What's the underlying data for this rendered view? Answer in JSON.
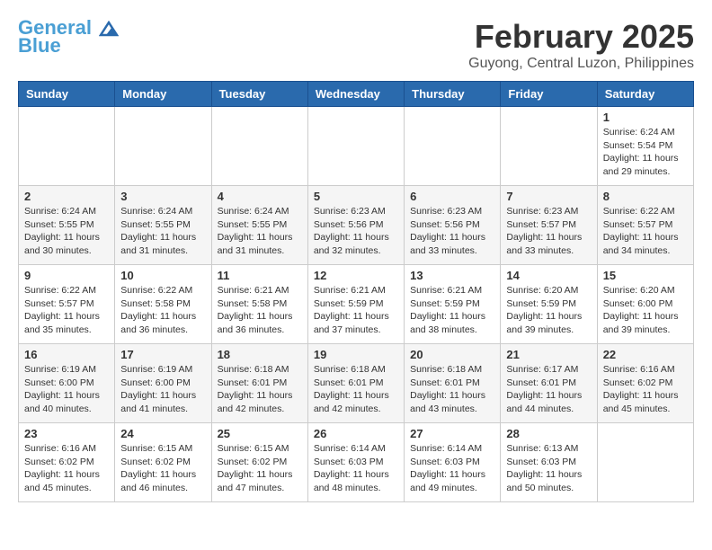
{
  "header": {
    "logo_line1": "General",
    "logo_line2": "Blue",
    "title": "February 2025",
    "subtitle": "Guyong, Central Luzon, Philippines"
  },
  "weekdays": [
    "Sunday",
    "Monday",
    "Tuesday",
    "Wednesday",
    "Thursday",
    "Friday",
    "Saturday"
  ],
  "weeks": [
    [
      {
        "day": "",
        "info": ""
      },
      {
        "day": "",
        "info": ""
      },
      {
        "day": "",
        "info": ""
      },
      {
        "day": "",
        "info": ""
      },
      {
        "day": "",
        "info": ""
      },
      {
        "day": "",
        "info": ""
      },
      {
        "day": "1",
        "info": "Sunrise: 6:24 AM\nSunset: 5:54 PM\nDaylight: 11 hours\nand 29 minutes."
      }
    ],
    [
      {
        "day": "2",
        "info": "Sunrise: 6:24 AM\nSunset: 5:55 PM\nDaylight: 11 hours\nand 30 minutes."
      },
      {
        "day": "3",
        "info": "Sunrise: 6:24 AM\nSunset: 5:55 PM\nDaylight: 11 hours\nand 31 minutes."
      },
      {
        "day": "4",
        "info": "Sunrise: 6:24 AM\nSunset: 5:55 PM\nDaylight: 11 hours\nand 31 minutes."
      },
      {
        "day": "5",
        "info": "Sunrise: 6:23 AM\nSunset: 5:56 PM\nDaylight: 11 hours\nand 32 minutes."
      },
      {
        "day": "6",
        "info": "Sunrise: 6:23 AM\nSunset: 5:56 PM\nDaylight: 11 hours\nand 33 minutes."
      },
      {
        "day": "7",
        "info": "Sunrise: 6:23 AM\nSunset: 5:57 PM\nDaylight: 11 hours\nand 33 minutes."
      },
      {
        "day": "8",
        "info": "Sunrise: 6:22 AM\nSunset: 5:57 PM\nDaylight: 11 hours\nand 34 minutes."
      }
    ],
    [
      {
        "day": "9",
        "info": "Sunrise: 6:22 AM\nSunset: 5:57 PM\nDaylight: 11 hours\nand 35 minutes."
      },
      {
        "day": "10",
        "info": "Sunrise: 6:22 AM\nSunset: 5:58 PM\nDaylight: 11 hours\nand 36 minutes."
      },
      {
        "day": "11",
        "info": "Sunrise: 6:21 AM\nSunset: 5:58 PM\nDaylight: 11 hours\nand 36 minutes."
      },
      {
        "day": "12",
        "info": "Sunrise: 6:21 AM\nSunset: 5:59 PM\nDaylight: 11 hours\nand 37 minutes."
      },
      {
        "day": "13",
        "info": "Sunrise: 6:21 AM\nSunset: 5:59 PM\nDaylight: 11 hours\nand 38 minutes."
      },
      {
        "day": "14",
        "info": "Sunrise: 6:20 AM\nSunset: 5:59 PM\nDaylight: 11 hours\nand 39 minutes."
      },
      {
        "day": "15",
        "info": "Sunrise: 6:20 AM\nSunset: 6:00 PM\nDaylight: 11 hours\nand 39 minutes."
      }
    ],
    [
      {
        "day": "16",
        "info": "Sunrise: 6:19 AM\nSunset: 6:00 PM\nDaylight: 11 hours\nand 40 minutes."
      },
      {
        "day": "17",
        "info": "Sunrise: 6:19 AM\nSunset: 6:00 PM\nDaylight: 11 hours\nand 41 minutes."
      },
      {
        "day": "18",
        "info": "Sunrise: 6:18 AM\nSunset: 6:01 PM\nDaylight: 11 hours\nand 42 minutes."
      },
      {
        "day": "19",
        "info": "Sunrise: 6:18 AM\nSunset: 6:01 PM\nDaylight: 11 hours\nand 42 minutes."
      },
      {
        "day": "20",
        "info": "Sunrise: 6:18 AM\nSunset: 6:01 PM\nDaylight: 11 hours\nand 43 minutes."
      },
      {
        "day": "21",
        "info": "Sunrise: 6:17 AM\nSunset: 6:01 PM\nDaylight: 11 hours\nand 44 minutes."
      },
      {
        "day": "22",
        "info": "Sunrise: 6:16 AM\nSunset: 6:02 PM\nDaylight: 11 hours\nand 45 minutes."
      }
    ],
    [
      {
        "day": "23",
        "info": "Sunrise: 6:16 AM\nSunset: 6:02 PM\nDaylight: 11 hours\nand 45 minutes."
      },
      {
        "day": "24",
        "info": "Sunrise: 6:15 AM\nSunset: 6:02 PM\nDaylight: 11 hours\nand 46 minutes."
      },
      {
        "day": "25",
        "info": "Sunrise: 6:15 AM\nSunset: 6:02 PM\nDaylight: 11 hours\nand 47 minutes."
      },
      {
        "day": "26",
        "info": "Sunrise: 6:14 AM\nSunset: 6:03 PM\nDaylight: 11 hours\nand 48 minutes."
      },
      {
        "day": "27",
        "info": "Sunrise: 6:14 AM\nSunset: 6:03 PM\nDaylight: 11 hours\nand 49 minutes."
      },
      {
        "day": "28",
        "info": "Sunrise: 6:13 AM\nSunset: 6:03 PM\nDaylight: 11 hours\nand 50 minutes."
      },
      {
        "day": "",
        "info": ""
      }
    ]
  ]
}
